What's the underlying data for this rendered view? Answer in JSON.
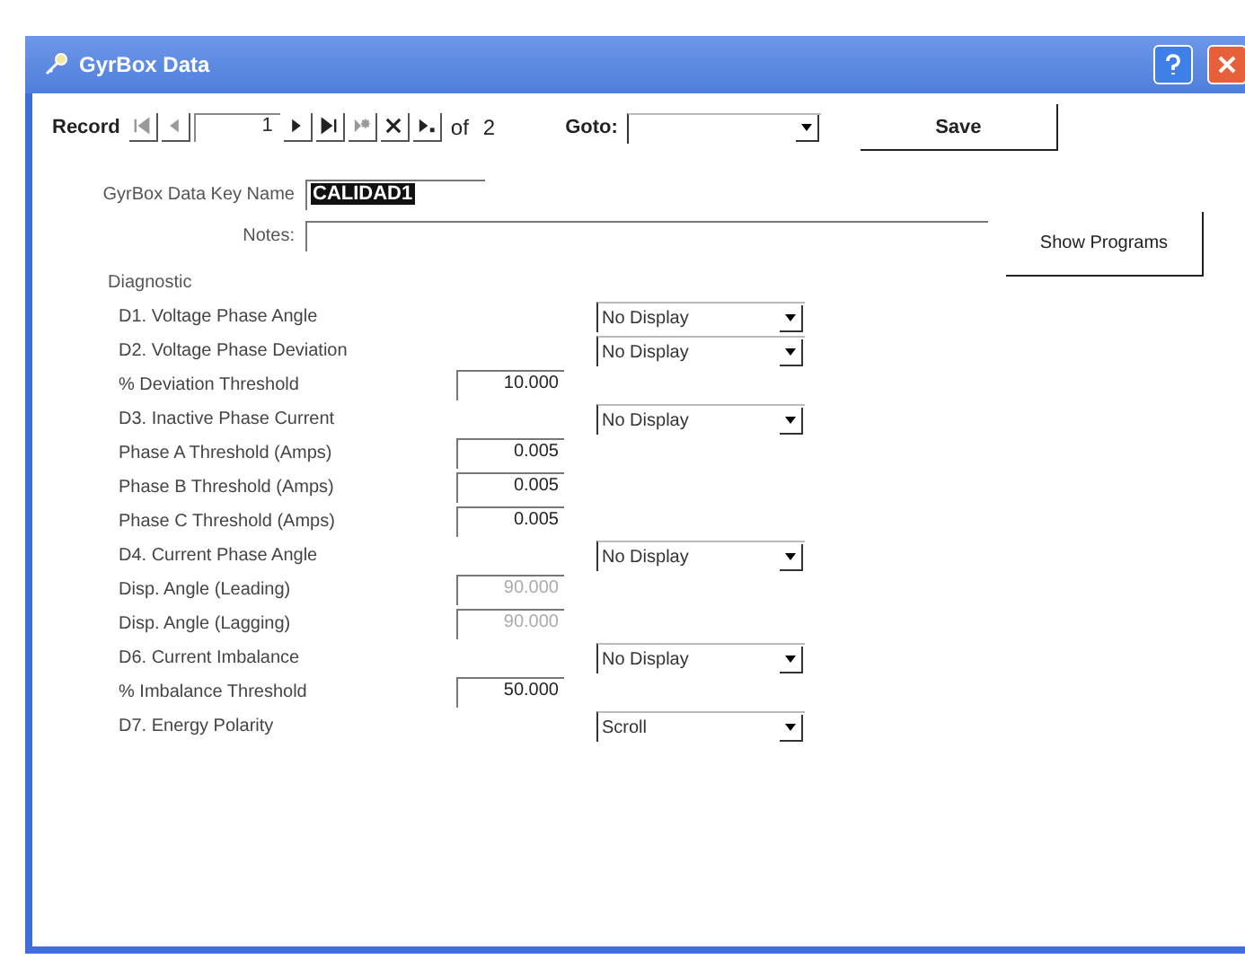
{
  "window": {
    "title": "GyrBox Data"
  },
  "toolbar": {
    "record_label": "Record",
    "record_number": "1",
    "of_label": "of",
    "record_count": "2",
    "goto_label": "Goto:",
    "save_button": "Save"
  },
  "key_name": {
    "label": "GyrBox Data Key Name",
    "value": "CALIDAD1",
    "selected": true
  },
  "notes": {
    "label": "Notes:"
  },
  "show_programs_button": "Show Programs",
  "diagnostic": {
    "heading": "Diagnostic",
    "rows": [
      {
        "kind": "select",
        "label": "D1. Voltage Phase Angle",
        "value": "No Display"
      },
      {
        "kind": "select",
        "label": "D2. Voltage Phase Deviation",
        "value": "No Display"
      },
      {
        "kind": "number",
        "label": "% Deviation Threshold",
        "value": "10.000",
        "disabled": false
      },
      {
        "kind": "select",
        "label": "D3. Inactive Phase Current",
        "value": "No Display"
      },
      {
        "kind": "number",
        "label": "Phase A Threshold (Amps)",
        "value": "0.005",
        "disabled": false
      },
      {
        "kind": "number",
        "label": "Phase B Threshold (Amps)",
        "value": "0.005",
        "disabled": false
      },
      {
        "kind": "number",
        "label": "Phase C Threshold (Amps)",
        "value": "0.005",
        "disabled": false
      },
      {
        "kind": "select",
        "label": "D4. Current Phase Angle",
        "value": "No Display"
      },
      {
        "kind": "number",
        "label": "Disp. Angle (Leading)",
        "value": "90.000",
        "disabled": true
      },
      {
        "kind": "number",
        "label": "Disp. Angle (Lagging)",
        "value": "90.000",
        "disabled": true
      },
      {
        "kind": "select",
        "label": "D6. Current Imbalance",
        "value": "No Display"
      },
      {
        "kind": "number",
        "label": "% Imbalance Threshold",
        "value": "50.000",
        "disabled": false
      },
      {
        "kind": "select",
        "label": "D7. Energy Polarity",
        "value": "Scroll"
      }
    ]
  }
}
